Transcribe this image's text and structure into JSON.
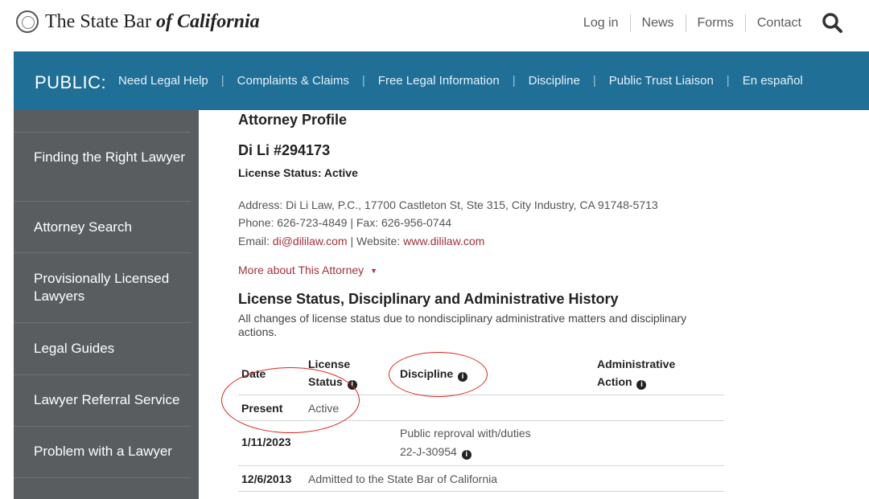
{
  "header": {
    "logo": {
      "text_main": "The State Bar ",
      "text_italic": "of California"
    },
    "links": [
      "Log in",
      "News",
      "Forms",
      "Contact"
    ]
  },
  "nav": {
    "label": "PUBLIC:",
    "links": [
      "Need Legal Help",
      "Complaints & Claims",
      "Free Legal Information",
      "Discipline",
      "Public Trust Liaison",
      "En español"
    ]
  },
  "sidebar": {
    "items": [
      "Finding the Right Lawyer",
      "Attorney Search",
      "Provisionally Licensed Lawyers",
      "Legal Guides",
      "Lawyer Referral Service",
      "Problem with a Lawyer"
    ]
  },
  "profile": {
    "section_title": "Attorney Profile",
    "name": "Di Li #294173",
    "license_status": "License Status: Active",
    "address": "Address: Di Li Law, P.C., 17700 Castleton St, Ste 315, City Industry, CA 91748-5713",
    "phone_line": "Phone: 626-723-4849  |  Fax: 626-956-0744",
    "email_label": "Email: ",
    "email": "di@dililaw.com",
    "website_label": "  |  Website: ",
    "website": "www.dililaw.com",
    "more_link": "More about This Attorney"
  },
  "history": {
    "title": "License Status, Disciplinary and Administrative History",
    "description": "All changes of license status due to nondisciplinary administrative matters and disciplinary actions.",
    "columns": {
      "date": "Date",
      "license_status_1": "License",
      "license_status_2": "Status",
      "discipline": "Discipline",
      "administrative_1": "Administrative",
      "administrative_2": "Action"
    },
    "rows": [
      {
        "date": "Present",
        "status": "Active",
        "discipline": "",
        "discipline_case": ""
      },
      {
        "date": "1/11/2023",
        "status": "",
        "discipline": "Public reproval with/duties",
        "discipline_case": "22-J-30954"
      },
      {
        "date": "12/6/2013",
        "status": "Admitted to the State Bar of California",
        "discipline": "",
        "discipline_case": ""
      }
    ]
  },
  "colors": {
    "nav_blue": "#1f6f96",
    "sidebar_gray": "#5a5d60",
    "link_red": "#a3323a",
    "annotation_red": "#d9261c"
  }
}
